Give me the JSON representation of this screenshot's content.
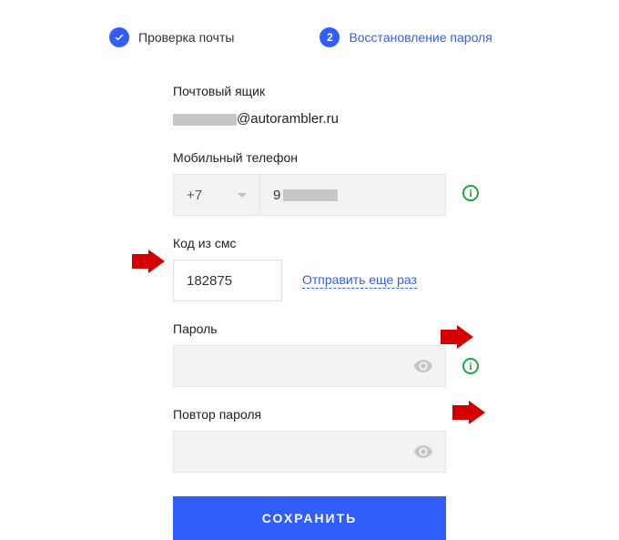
{
  "stepper": {
    "step1_label": "Проверка почты",
    "step2_label": "Восстановление пароля",
    "step2_number": "2"
  },
  "email": {
    "label": "Почтовый ящик",
    "domain": "@autorambler.ru"
  },
  "phone": {
    "label": "Мобильный телефон",
    "country_code": "+7",
    "number_prefix": "9"
  },
  "sms": {
    "label": "Код из смс",
    "value": "182875",
    "resend_label": "Отправить еще раз"
  },
  "password": {
    "label": "Пароль"
  },
  "password_repeat": {
    "label": "Повтор пароля"
  },
  "save_button": "СОХРАНИТЬ",
  "info_glyph": "i"
}
